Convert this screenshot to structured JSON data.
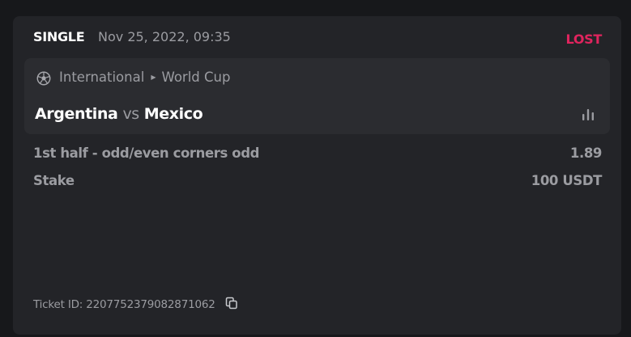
{
  "bet": {
    "type": "SINGLE",
    "date": "Nov 25, 2022, 09:35",
    "status": "LOST",
    "status_color": "#e0245e"
  },
  "event": {
    "sport_icon": "soccer-ball-icon",
    "category": "International",
    "league": "World Cup",
    "home_team": "Argentina",
    "vs": "vs",
    "away_team": "Mexico",
    "stats_icon": "bar-chart-icon"
  },
  "selection": {
    "market": "1st half - odd/even corners odd",
    "odds": "1.89"
  },
  "stake": {
    "label": "Stake",
    "value": "100 USDT"
  },
  "ticket": {
    "label": "Ticket ID: 2207752379082871062",
    "copy_icon": "copy-icon"
  }
}
